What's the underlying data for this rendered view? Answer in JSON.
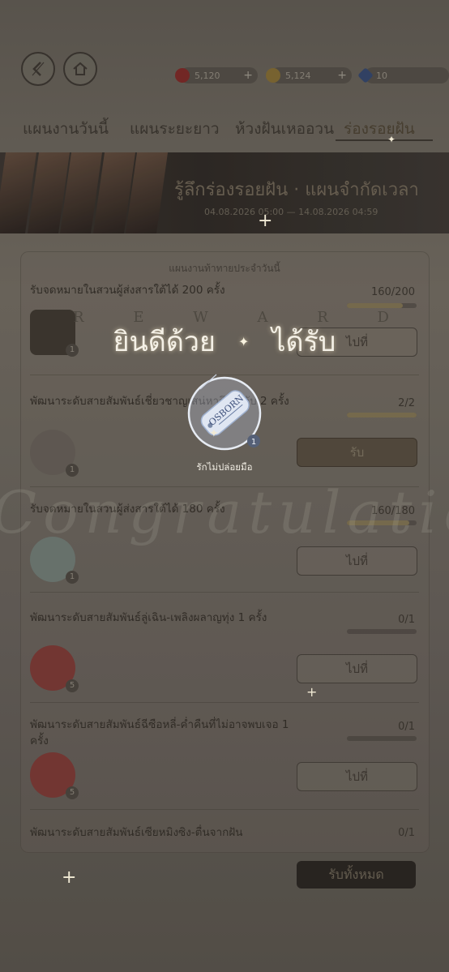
{
  "resources": [
    {
      "name": "ruby-icon",
      "value": "5,120",
      "color": "#b2242a"
    },
    {
      "name": "coin-icon",
      "value": "5,124",
      "color": "#c19a39"
    },
    {
      "name": "crystal-icon",
      "value": "10",
      "color": "#3d5aa8"
    }
  ],
  "tabs": [
    {
      "label": "แผนงานวันนี้"
    },
    {
      "label": "แผนระยะยาว"
    },
    {
      "label": "ห้วงฝันเหออวน"
    },
    {
      "label": "ร่องรอยฝัน",
      "active": true
    }
  ],
  "banner": {
    "title": "รู้ลึกร่องรอยฝัน · แผนจำกัดเวลา",
    "date": "04.08.2026 05:00 — 14.08.2026 04:59"
  },
  "list": {
    "subheading": "แผนงานท้าทายประจำวันนี้",
    "rows": [
      {
        "title": "รับจดหมายในสวนผู้ส่งสารใต้ได้ 200 ครั้ง",
        "count": "160/200",
        "progress": 0.8,
        "button": "ไปที่",
        "qty": "1"
      },
      {
        "title": "พัฒนาระดับสายสัมพันธ์เชี่ยวชาญเสน่หาถึงระดับ 2 ครั้ง",
        "count": "2/2",
        "progress": 1.0,
        "button": "รับ",
        "qty": "1"
      },
      {
        "title": "รับจดหมายในสวนผู้ส่งสารใต้ได้ 180 ครั้ง",
        "count": "160/180",
        "progress": 0.89,
        "button": "ไปที่",
        "qty": "1"
      },
      {
        "title": "พัฒนาระดับสายสัมพันธ์ลู่เฉิน-เพลิงผลาญทุ่ง 1 ครั้ง",
        "count": "0/1",
        "progress": 0.0,
        "button": "ไปที่",
        "qty": "5"
      },
      {
        "title": "พัฒนาระดับสายสัมพันธ์ฉีซือหลี่-ค่ำคืนที่ไม่อาจพบเจอ 1 ครั้ง",
        "count": "0/1",
        "progress": 0.0,
        "button": "ไปที่",
        "qty": "5"
      },
      {
        "title": "พัฒนาระดับสายสัมพันธ์เซียหมิงซิง-ตื่นจากฝัน",
        "count": "0/1",
        "progress": 0.0
      }
    ],
    "claim_all": "รับทั้งหมด"
  },
  "overlay": {
    "reward_letters": [
      "R",
      "E",
      "W",
      "A",
      "R",
      "D"
    ],
    "congrats_left": "ยินดีด้วย",
    "congrats_right": "ได้รับ",
    "star": "✦",
    "reward_name": "รักไม่ปล่อยมือ",
    "reward_qty": "1",
    "tag_text": "OSBORN",
    "watermark": "Congratulations"
  }
}
